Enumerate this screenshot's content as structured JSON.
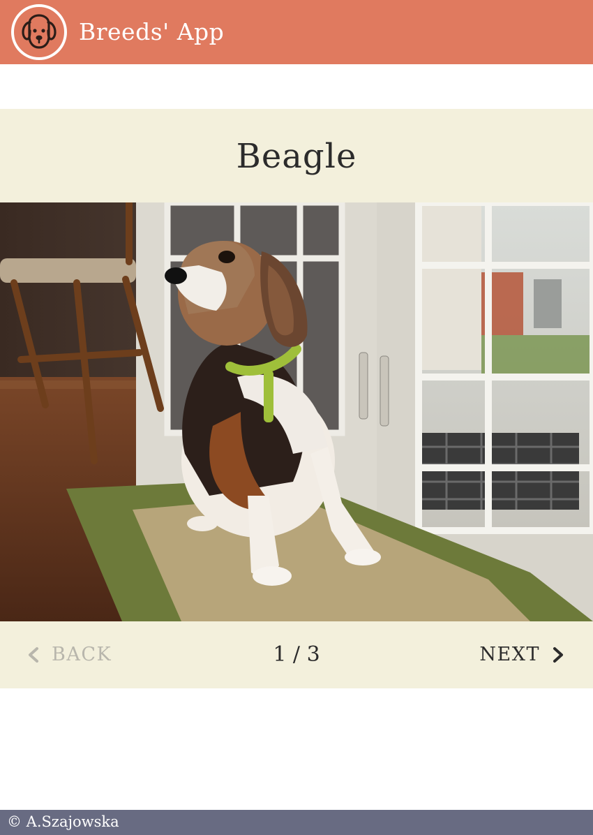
{
  "header": {
    "app_title": "Breeds' App",
    "logo_icon": "dog-face-icon",
    "background": "#e07a5f"
  },
  "breed": {
    "name": "Beagle",
    "photo_alt": "Beagle"
  },
  "pagination": {
    "back_label": "BACK",
    "next_label": "NEXT",
    "counter": "1 / 3",
    "back_disabled": true
  },
  "footer": {
    "copyright": "© A.Szajowska",
    "background": "#686b82"
  },
  "colors": {
    "band": "#f3f0dc",
    "text": "#2b2b2b",
    "disabled": "#b8b6ac"
  }
}
